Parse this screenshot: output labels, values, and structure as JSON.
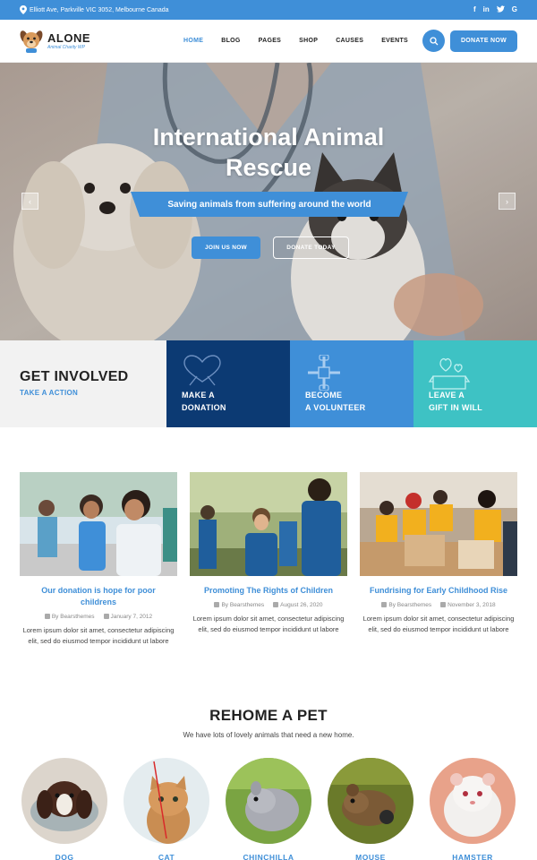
{
  "topbar": {
    "address": "Elliott Ave, Parkville VIC 3052, Melbourne Canada",
    "social": [
      "f",
      "in",
      "t",
      "G"
    ]
  },
  "header": {
    "logo_name": "ALONE",
    "logo_tagline": "Animal Charity WP",
    "nav": [
      "HOME",
      "BLOG",
      "PAGES",
      "SHOP",
      "CAUSES",
      "EVENTS"
    ],
    "active_nav": "HOME",
    "donate_label": "DONATE NOW"
  },
  "hero": {
    "title_line1": "International Animal",
    "title_line2": "Rescue",
    "subtitle": "Saving animals from suffering around the world",
    "join_label": "JOIN US NOW",
    "donate_label": "DONATE TODAY",
    "prev_icon": "‹",
    "next_icon": "›"
  },
  "involved": {
    "heading": "GET INVOLVED",
    "subheading": "TAKE A ACTION",
    "boxes": [
      {
        "line1": "MAKE A",
        "line2": "DONATION",
        "icon": "hands-heart-icon",
        "color": "#0c3a73"
      },
      {
        "line1": "BECOME",
        "line2": "A VOLUNTEER",
        "icon": "team-hands-icon",
        "color": "#3f8fd8"
      },
      {
        "line1": "LEAVE A",
        "line2": "GIFT IN WILL",
        "icon": "gift-box-icon",
        "color": "#3ec2c4"
      }
    ]
  },
  "posts": [
    {
      "title": "Our donation is hope for poor childrens",
      "author": "By Bearsthemes",
      "date": "January 7, 2012",
      "excerpt": "Lorem ipsum dolor sit amet, consectetur adipiscing elit, sed do eiusmod tempor incididunt ut labore"
    },
    {
      "title": "Promoting The Rights of Children",
      "author": "By Bearsthemes",
      "date": "August 26, 2020",
      "excerpt": "Lorem ipsum dolor sit amet, consectetur adipiscing elit, sed do eiusmod tempor incididunt ut labore"
    },
    {
      "title": "Fundrising for Early Childhood Rise",
      "author": "By Bearsthemes",
      "date": "November 3, 2018",
      "excerpt": "Lorem ipsum dolor sit amet, consectetur adipiscing elit, sed do eiusmod tempor incididunt ut labore"
    }
  ],
  "rehome": {
    "title": "REHOME A PET",
    "subtitle": "We have lots of lovely animals that need a new home.",
    "pets": [
      "DOG",
      "CAT",
      "CHINCHILLA",
      "MOUSE",
      "HAMSTER"
    ]
  },
  "colors": {
    "primary": "#3f8fd8",
    "navy": "#0c3a73",
    "teal": "#3ec2c4"
  }
}
